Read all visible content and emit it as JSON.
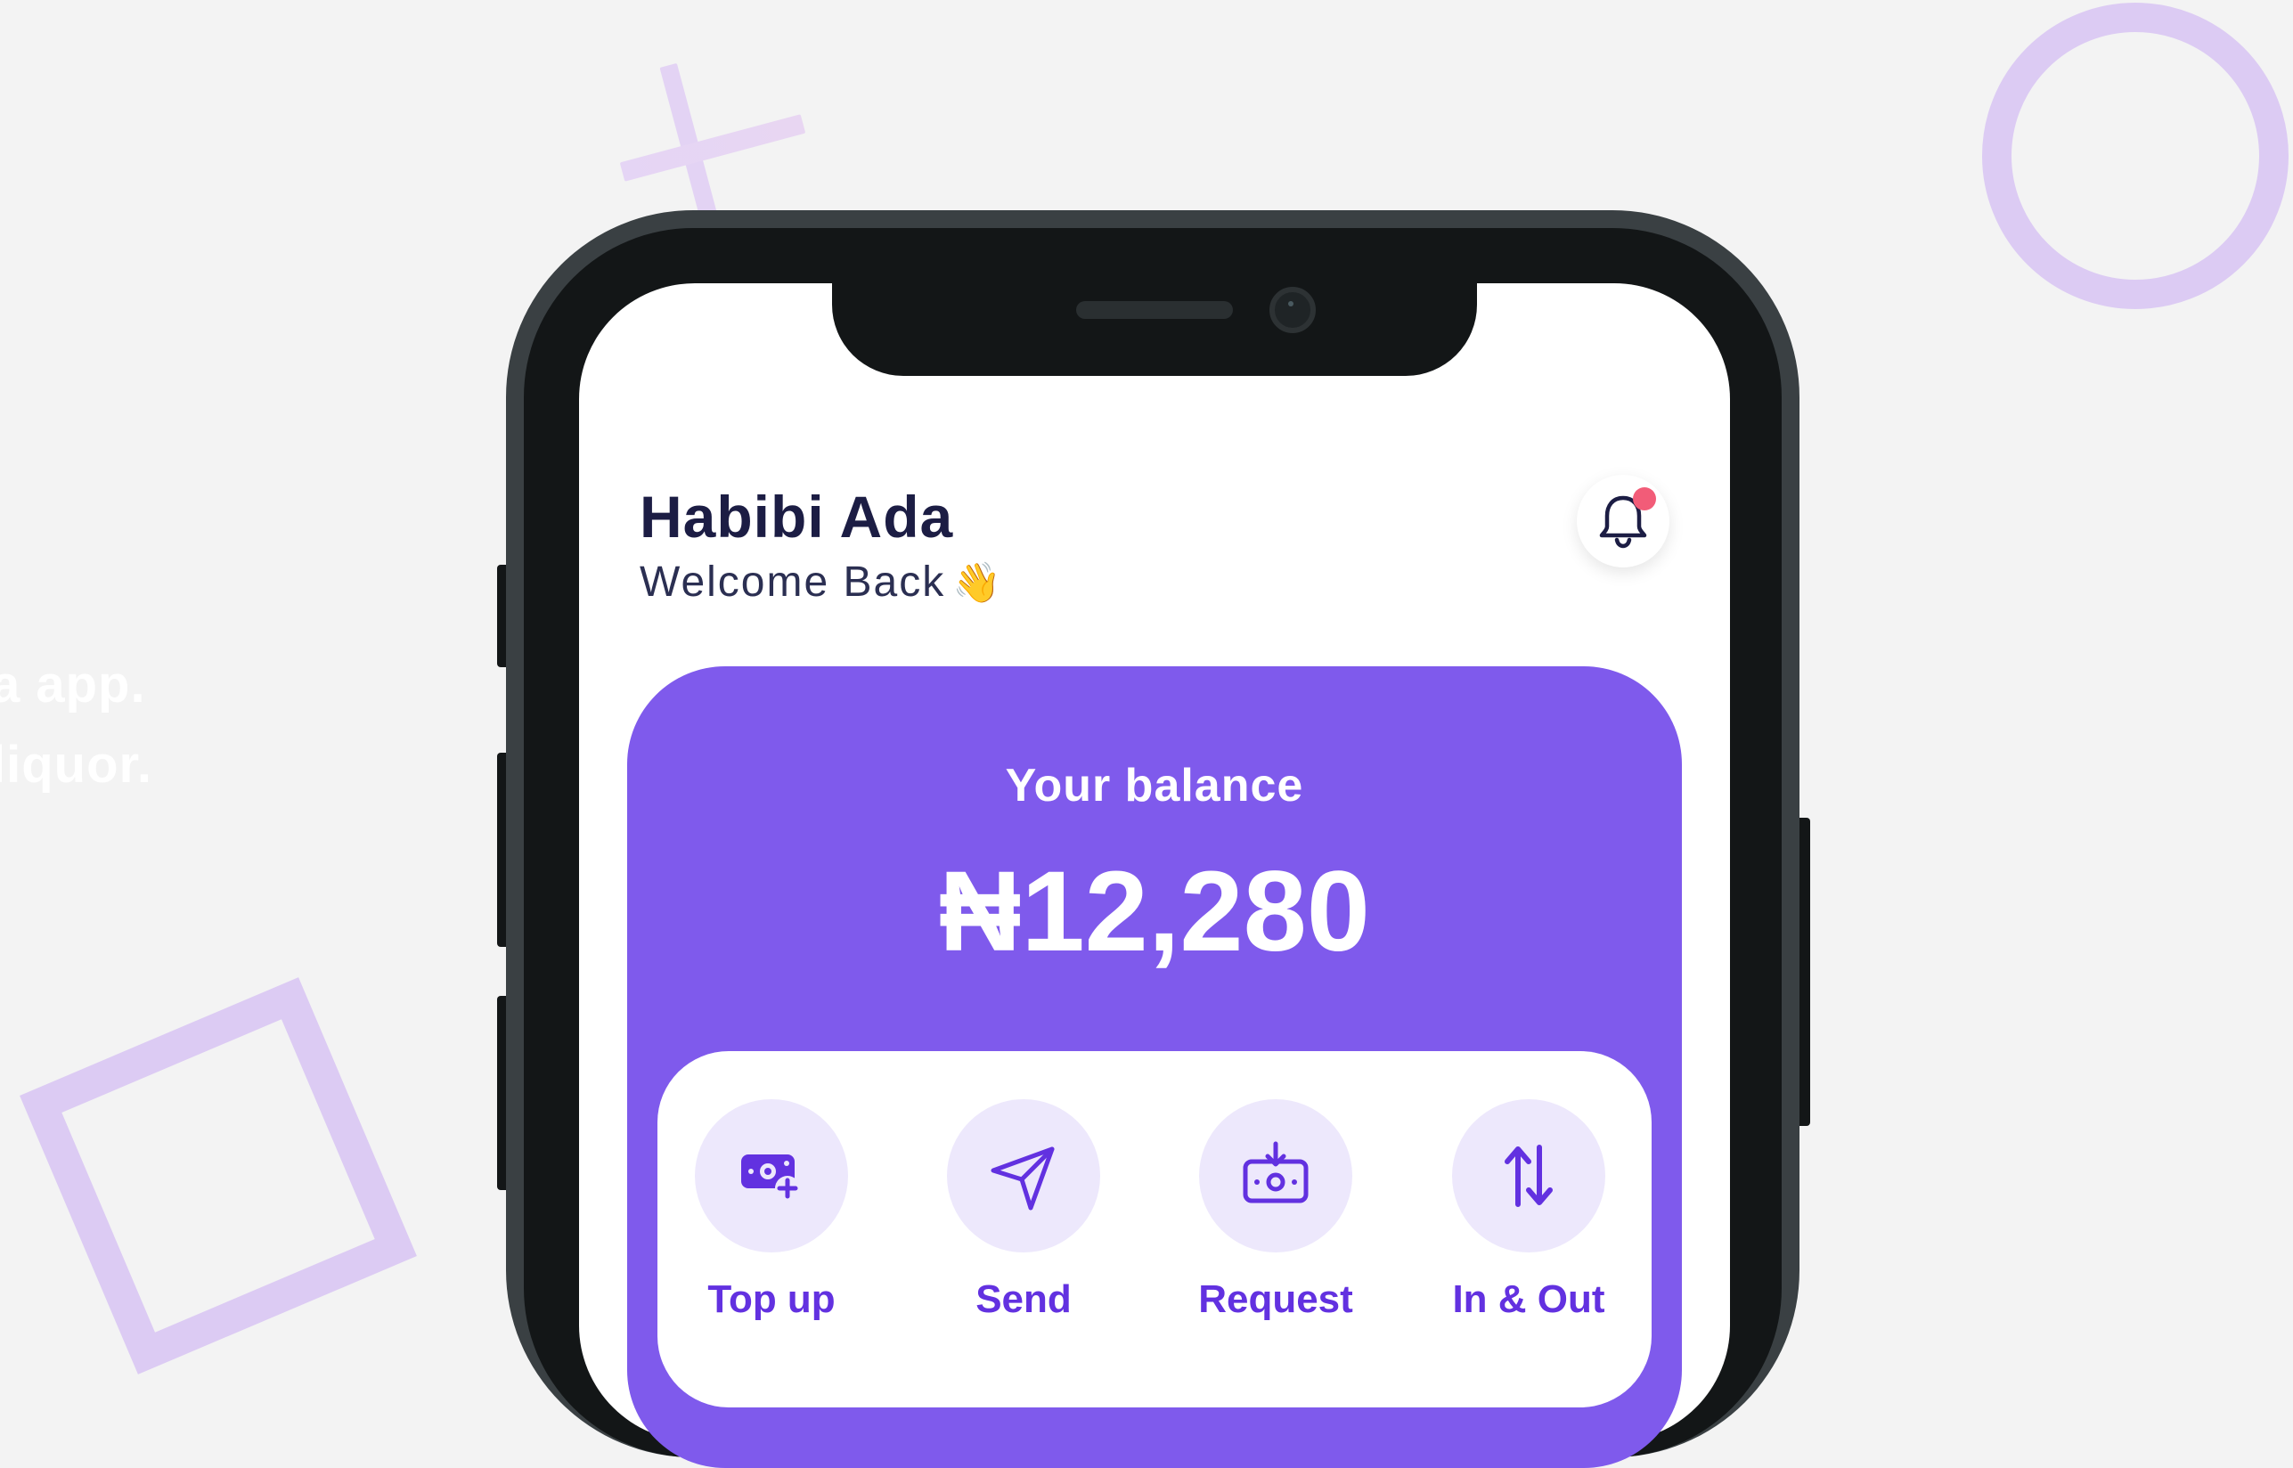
{
  "background": {
    "decor_text_line1": "a app.",
    "decor_text_line2": "liquor."
  },
  "header": {
    "user_name": "Habibi Ada",
    "welcome_text": "Welcome Back",
    "welcome_emoji": "👋",
    "notification_icon": "bell-icon",
    "has_unread_notification": true
  },
  "balance": {
    "label": "Your balance",
    "amount": "₦12,280"
  },
  "actions": [
    {
      "label": "Top up",
      "icon": "money-plus-icon"
    },
    {
      "label": "Send",
      "icon": "send-icon"
    },
    {
      "label": "Request",
      "icon": "money-receive-icon"
    },
    {
      "label": "In & Out",
      "icon": "arrows-up-down-icon"
    }
  ],
  "colors": {
    "accent": "#7f5aec",
    "action_text": "#6231e0",
    "action_bg": "#ede8fc",
    "notification_dot": "#f25c78",
    "name_text": "#1c1d44"
  }
}
